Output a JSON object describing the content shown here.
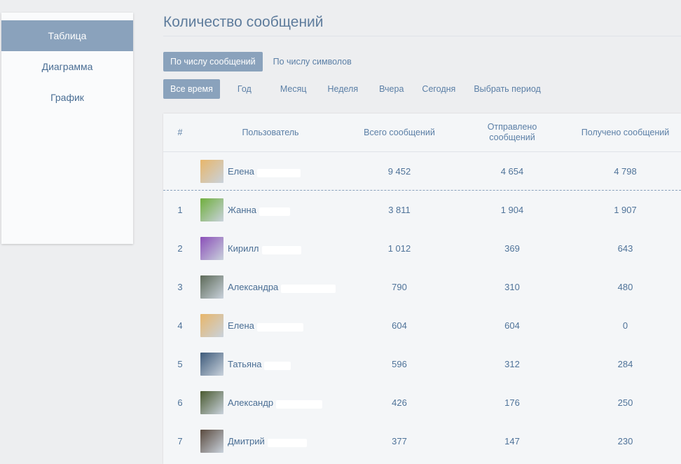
{
  "sidebar": {
    "items": [
      {
        "label": "Таблица",
        "active": true
      },
      {
        "label": "Диаграмма",
        "active": false
      },
      {
        "label": "График",
        "active": false
      }
    ]
  },
  "title": "Количество сообщений",
  "mode_tabs": [
    "По числу сообщений",
    "По числу символов"
  ],
  "period_tabs": [
    "Все время",
    "Год",
    "Месяц",
    "Неделя",
    "Вчера",
    "Сегодня",
    "Выбрать период"
  ],
  "table": {
    "headers": {
      "rank": "#",
      "user": "Пользователь",
      "total": "Всего сообщений",
      "sent": "Отправлено сообщений",
      "received": "Получено сообщений"
    },
    "me": {
      "rank": "",
      "name": "Елена",
      "total": "9 452",
      "sent": "4 654",
      "received": "4 798",
      "avatar_color": "#e8b66a"
    },
    "rows": [
      {
        "rank": "1",
        "name": "Жанна",
        "total": "3 811",
        "sent": "1 904",
        "received": "1 907",
        "avatar_color": "#6fae3c"
      },
      {
        "rank": "2",
        "name": "Кирилл",
        "total": "1 012",
        "sent": "369",
        "received": "643",
        "avatar_color": "#8a4fb8"
      },
      {
        "rank": "3",
        "name": "Александра",
        "total": "790",
        "sent": "310",
        "received": "480",
        "avatar_color": "#5d6a58"
      },
      {
        "rank": "4",
        "name": "Елена",
        "total": "604",
        "sent": "604",
        "received": "0",
        "avatar_color": "#e8b66a"
      },
      {
        "rank": "5",
        "name": "Татьяна",
        "total": "596",
        "sent": "312",
        "received": "284",
        "avatar_color": "#3d5a7a"
      },
      {
        "rank": "6",
        "name": "Александр",
        "total": "426",
        "sent": "176",
        "received": "250",
        "avatar_color": "#4a5a30"
      },
      {
        "rank": "7",
        "name": "Дмитрий",
        "total": "377",
        "sent": "147",
        "received": "230",
        "avatar_color": "#5a4a3e"
      }
    ]
  },
  "colors": {
    "accent": "#8aa2bc",
    "link": "#4a6e94",
    "background": "#edeef0"
  }
}
